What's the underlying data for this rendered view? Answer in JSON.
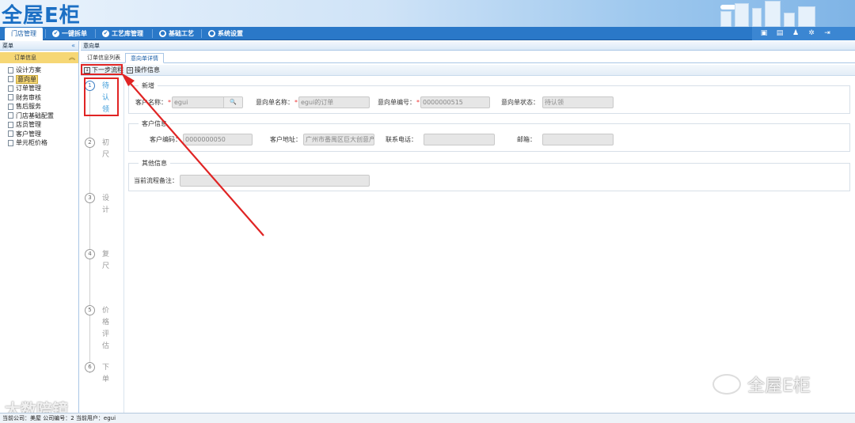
{
  "header": {
    "logo_text": "全屋E柜"
  },
  "nav": {
    "items": [
      "门店管理",
      "一键拆单",
      "工艺库管理",
      "基础工艺",
      "系统设置"
    ]
  },
  "sidebar": {
    "header": "菜单",
    "collapse_glyph": "«",
    "group": "订单信息",
    "items": [
      "设计方案",
      "意向单",
      "订单管理",
      "财务审核",
      "售后服务",
      "门店基础配置",
      "店员管理",
      "客户管理",
      "单元柜价格"
    ]
  },
  "main": {
    "header": "意向单",
    "tabs": [
      "订单信息列表",
      "意向单详情"
    ],
    "toolbar": {
      "next_step": "下一步流程",
      "operation_info": "操作信息"
    }
  },
  "steps": [
    {
      "num": "1",
      "label": "待认领"
    },
    {
      "num": "2",
      "label": "初尺"
    },
    {
      "num": "3",
      "label": "设计"
    },
    {
      "num": "4",
      "label": "复尺"
    },
    {
      "num": "5",
      "label": "价格评估"
    },
    {
      "num": "6",
      "label": "下单"
    }
  ],
  "form": {
    "section_new": {
      "legend": "新增",
      "customer_name_label": "客户名称：",
      "customer_name_value": "egui",
      "order_name_label": "意向单名称：",
      "order_name_value": "egui的订单",
      "order_no_label": "意向单编号：",
      "order_no_value": "0000000515",
      "order_status_label": "意向单状态：",
      "order_status_value": "待认领"
    },
    "section_customer": {
      "legend": "客户信息",
      "customer_code_label": "客户编码：",
      "customer_code_value": "0000000050",
      "address_label": "客户地址：",
      "address_value": "广州市番禺区巨大创意产",
      "phone_label": "联系电话：",
      "phone_value": "",
      "email_label": "邮箱：",
      "email_value": ""
    },
    "section_other": {
      "legend": "其他信息",
      "remark_label": "当前流程备注：",
      "remark_value": ""
    }
  },
  "watermarks": {
    "left": "大数陪镜",
    "right": "全屋E柜"
  },
  "statusbar": {
    "text": "当前公司：美屋 公司编号：2 当前用户：egui"
  },
  "colors": {
    "nav": "#2a78c8",
    "accent": "#3a7cc2",
    "annotation": "#e02424",
    "selected_item": "#f6d775"
  }
}
